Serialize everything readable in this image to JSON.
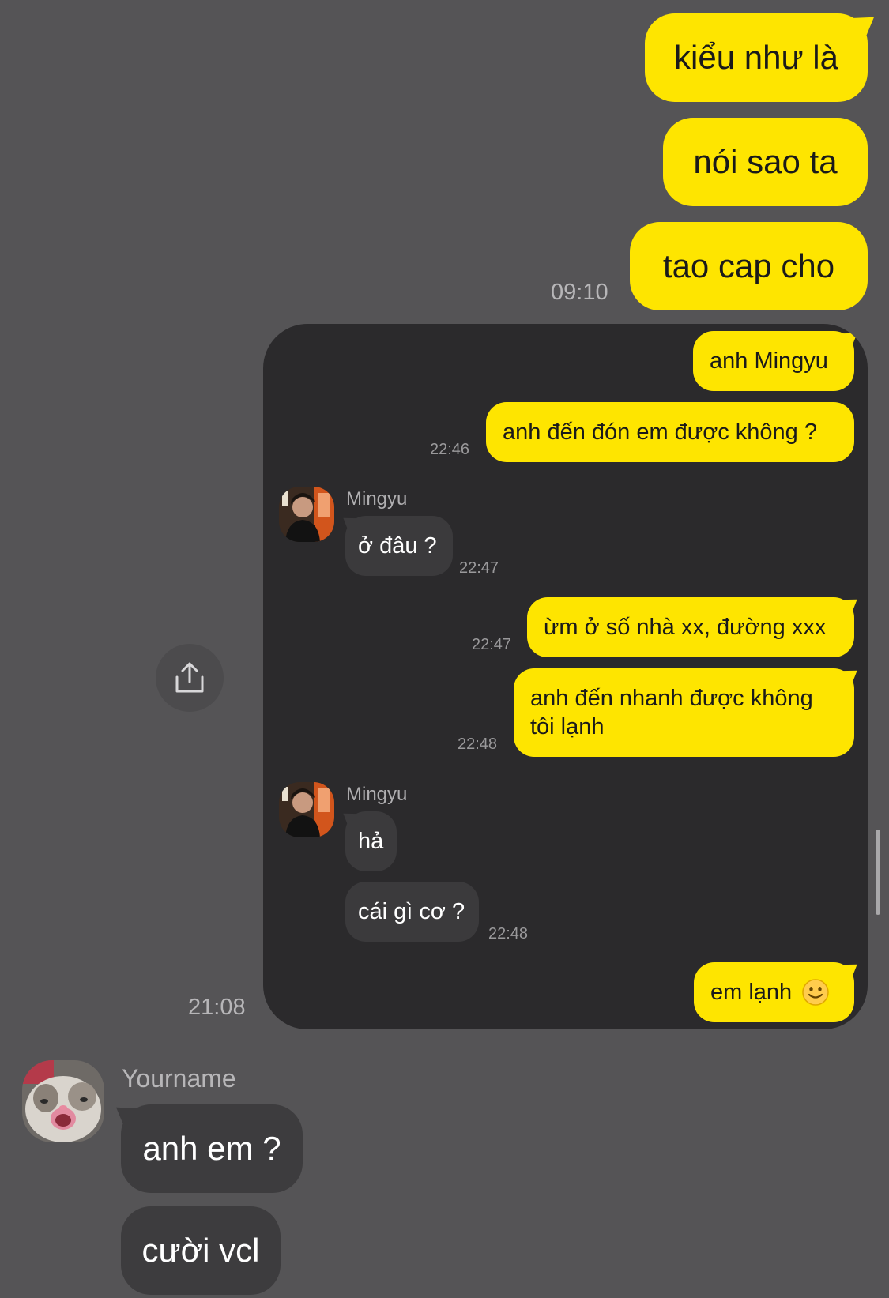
{
  "outer_messages": {
    "sent": [
      {
        "text": "kiểu như là"
      },
      {
        "text": "nói sao ta"
      },
      {
        "text": "tao cap cho"
      }
    ],
    "sent_time": "09:10",
    "card_time": "21:08",
    "received": {
      "sender": "Yourname",
      "messages": [
        {
          "text": "anh em ?"
        },
        {
          "text": "cười vcl"
        }
      ]
    }
  },
  "card": {
    "messages": [
      {
        "text": "anh Mingyu"
      },
      {
        "text": "anh đến đón em được không ?",
        "time": "22:46"
      },
      {
        "sender": "Mingyu",
        "text": "ở đâu ?",
        "time": "22:47"
      },
      {
        "text": "ừm ở số nhà xx, đường xxx",
        "time": "22:47"
      },
      {
        "text_line1": "anh đến nhanh được không",
        "text_line2": "tôi lạnh",
        "time": "22:48"
      },
      {
        "sender": "Mingyu",
        "text": "hả"
      },
      {
        "text": "cái gì cơ ?",
        "time": "22:48"
      },
      {
        "text": "em lạnh",
        "emoji": "🙂"
      }
    ]
  },
  "icons": {
    "share": "share-icon",
    "avatar_contact": "mingyu-avatar",
    "avatar_sender": "cat-avatar"
  },
  "colors": {
    "background": "#555456",
    "sent_bubble": "#FEE500",
    "received_bubble": "#3d3c3e",
    "card_background": "#2b2a2c"
  }
}
